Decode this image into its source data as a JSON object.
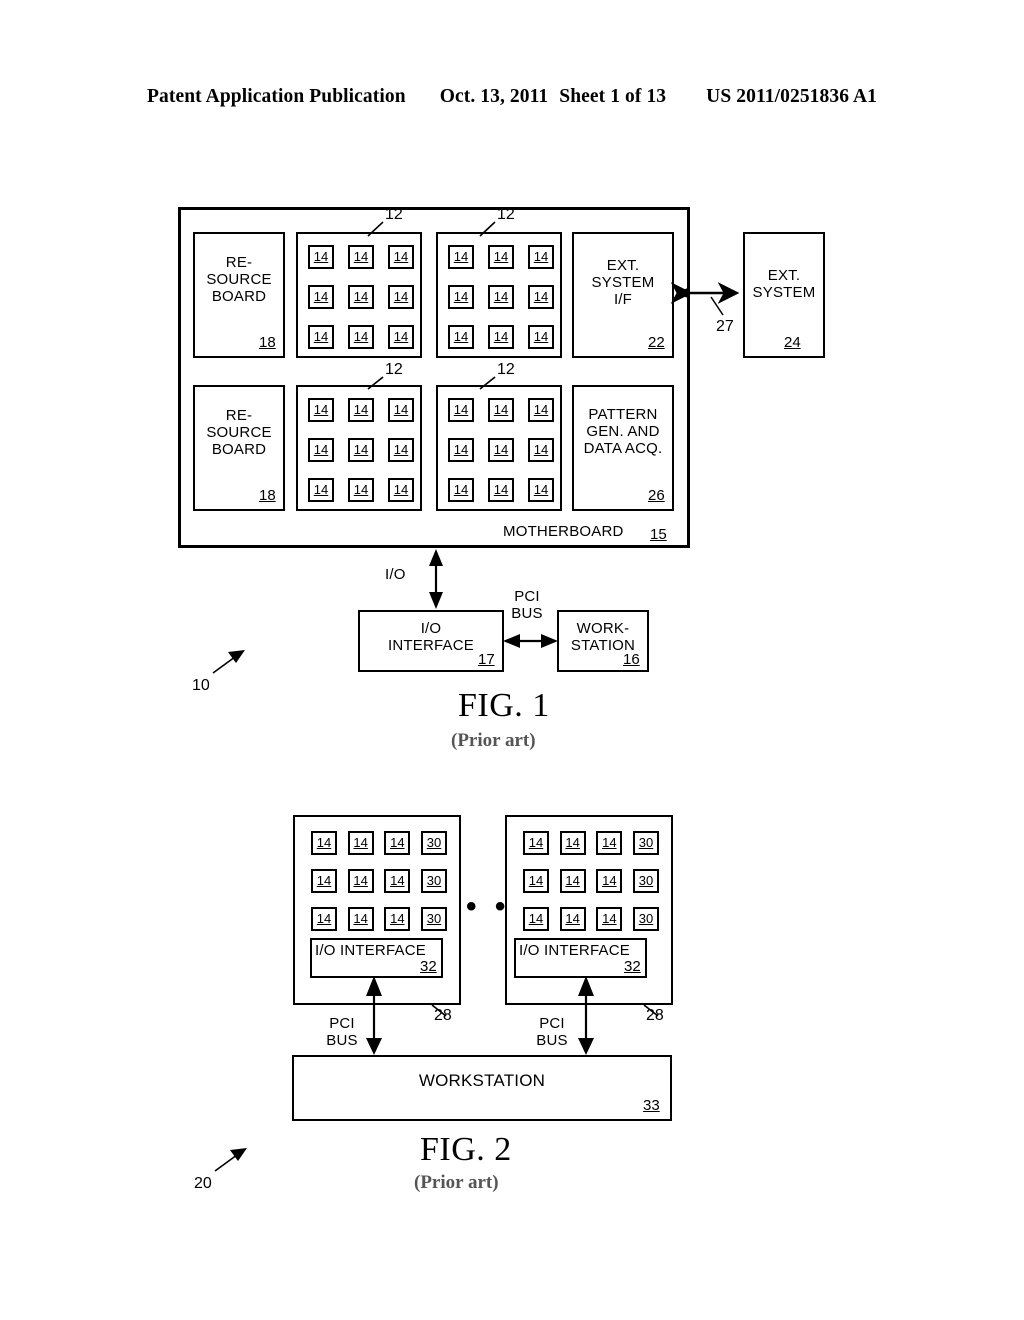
{
  "header": {
    "publication": "Patent Application Publication",
    "date": "Oct. 13, 2011",
    "sheet": "Sheet 1 of 13",
    "pub_number": "US 2011/0251836 A1"
  },
  "fig1": {
    "caption": "FIG. 1",
    "subcaption": "(Prior art)",
    "system_ref": "10",
    "motherboard": {
      "label": "MOTHERBOARD",
      "ref": "15"
    },
    "resource_boards": [
      {
        "label": "RE-\nSOURCE\nBOARD",
        "ref": "18"
      },
      {
        "label": "RE-\nSOURCE\nBOARD",
        "ref": "18"
      }
    ],
    "grids": [
      {
        "ref": "12",
        "ref_position": "top",
        "cell_label": "14",
        "rows": 3,
        "cols": 3
      },
      {
        "ref": "12",
        "ref_position": "top",
        "cell_label": "14",
        "rows": 3,
        "cols": 3
      },
      {
        "ref": "12",
        "ref_position": "top",
        "cell_label": "14",
        "rows": 3,
        "cols": 3
      },
      {
        "ref": "12",
        "ref_position": "top",
        "cell_label": "14",
        "rows": 3,
        "cols": 3
      }
    ],
    "ext_system_if": {
      "label": "EXT.\nSYSTEM\nI/F",
      "ref": "22"
    },
    "ext_system": {
      "label": "EXT.\nSYSTEM",
      "ref": "24"
    },
    "ext_link_ref": "27",
    "pattern_gen": {
      "label": "PATTERN\nGEN. AND\nDATA ACQ.",
      "ref": "26"
    },
    "io_interface": {
      "label": "I/O\nINTERFACE",
      "ref": "17"
    },
    "workstation": {
      "label": "WORK-\nSTATION",
      "ref": "16"
    },
    "io_bus_label": "I/O",
    "pci_bus_label": "PCI\nBUS"
  },
  "fig2": {
    "caption": "FIG. 2",
    "subcaption": "(Prior art)",
    "system_ref": "20",
    "ellipsis": "• • •",
    "panels": [
      {
        "ref": "28",
        "cell_labels": [
          "14",
          "14",
          "14",
          "30"
        ],
        "rows": 3,
        "io_interface": {
          "label": "I/O INTERFACE",
          "ref": "32"
        },
        "bus_label": "PCI\nBUS"
      },
      {
        "ref": "28",
        "cell_labels": [
          "14",
          "14",
          "14",
          "30"
        ],
        "rows": 3,
        "io_interface": {
          "label": "I/O INTERFACE",
          "ref": "32"
        },
        "bus_label": "PCI\nBUS"
      }
    ],
    "workstation": {
      "label": "WORKSTATION",
      "ref": "33"
    }
  }
}
